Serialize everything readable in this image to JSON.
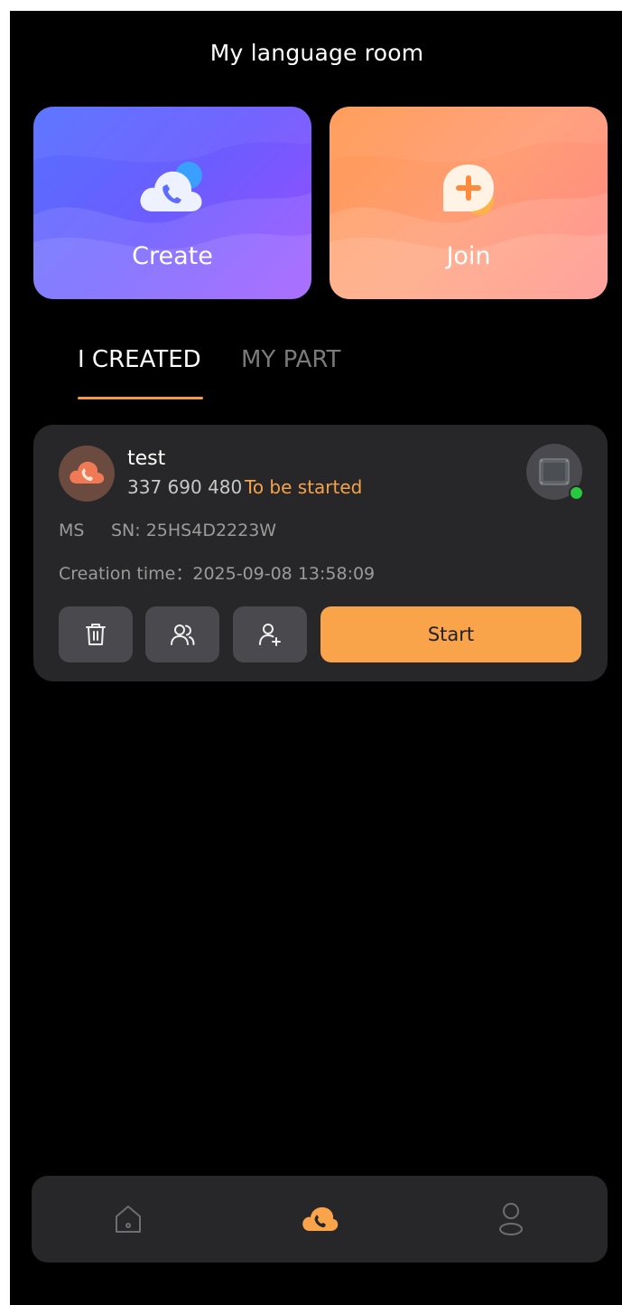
{
  "header": {
    "title": "My language room"
  },
  "actions": {
    "create": {
      "label": "Create",
      "icon": "cloud-phone-icon"
    },
    "join": {
      "label": "Join",
      "icon": "plus-bubble-icon"
    }
  },
  "tabs": [
    {
      "label": "I CREATED",
      "active": true
    },
    {
      "label": "MY PART",
      "active": false
    }
  ],
  "room": {
    "name": "test",
    "number": "337 690 480",
    "status": "To be started",
    "model": "MS",
    "sn": "SN: 25HS4D2223W",
    "creation_time": "Creation time：2025-09-08 13:58:09",
    "device_online": true,
    "buttons": {
      "delete_icon": "trash-icon",
      "members_icon": "users-icon",
      "invite_icon": "add-user-icon",
      "start_label": "Start"
    }
  },
  "nav": {
    "items": [
      {
        "icon": "home-icon",
        "active": false
      },
      {
        "icon": "cloud-phone-icon",
        "active": true
      },
      {
        "icon": "person-icon",
        "active": false
      }
    ]
  },
  "colors": {
    "accent": "#f9a44a",
    "status": "#f5a34a",
    "online": "#28c840",
    "create_gradient": [
      "#5570ff",
      "#9a4dff"
    ],
    "join_gradient": [
      "#ff9a52",
      "#ff8585"
    ]
  }
}
